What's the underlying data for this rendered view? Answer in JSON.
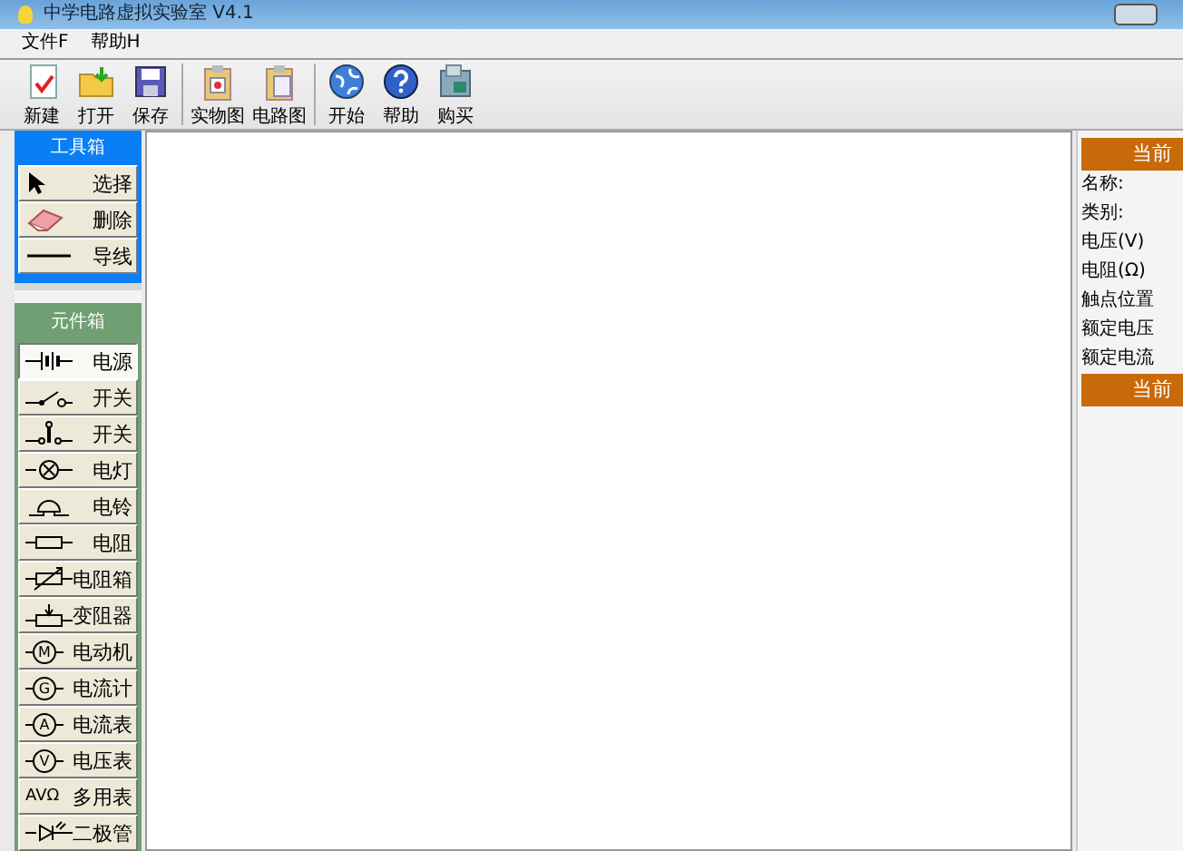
{
  "window": {
    "title": "中学电路虚拟实验室 V4.1"
  },
  "menu": [
    {
      "label": "文件F"
    },
    {
      "label": "帮助H"
    }
  ],
  "toolbar": [
    {
      "label": "新建"
    },
    {
      "label": "打开"
    },
    {
      "label": "保存"
    },
    {
      "label": "实物图"
    },
    {
      "label": "电路图"
    },
    {
      "label": "开始"
    },
    {
      "label": "帮助"
    },
    {
      "label": "购买"
    }
  ],
  "toolbox": {
    "title": "工具箱",
    "items": [
      {
        "label": "选择"
      },
      {
        "label": "删除"
      },
      {
        "label": "导线"
      }
    ]
  },
  "component_box": {
    "title": "元件箱",
    "items": [
      {
        "label": "电源",
        "kind": "symbol",
        "selected": true
      },
      {
        "label": "开关",
        "kind": "symbol",
        "selected": false
      },
      {
        "label": "开关",
        "kind": "symbol",
        "selected": false
      },
      {
        "label": "电灯",
        "kind": "symbol",
        "selected": false
      },
      {
        "label": "电铃",
        "kind": "symbol",
        "selected": false
      },
      {
        "label": "电阻",
        "kind": "symbol",
        "selected": false
      },
      {
        "label": "电阻箱",
        "kind": "symbol",
        "selected": false
      },
      {
        "label": "变阻器",
        "kind": "symbol",
        "selected": false
      },
      {
        "label": "电动机",
        "kind": "meter",
        "letter": "M",
        "selected": false
      },
      {
        "label": "电流计",
        "kind": "meter",
        "letter": "G",
        "selected": false
      },
      {
        "label": "电流表",
        "kind": "meter",
        "letter": "A",
        "selected": false
      },
      {
        "label": "电压表",
        "kind": "meter",
        "letter": "V",
        "selected": false
      },
      {
        "label": "多用表",
        "kind": "text",
        "symbol_text": "AVΩ",
        "selected": false
      },
      {
        "label": "二极管",
        "kind": "symbol",
        "selected": false
      }
    ]
  },
  "properties": {
    "header": "当前",
    "fields": [
      "名称:",
      "类别:",
      "电压(V)",
      "电阻(Ω)",
      "触点位置",
      "额定电压",
      "额定电流"
    ],
    "footer_header": "当前"
  }
}
